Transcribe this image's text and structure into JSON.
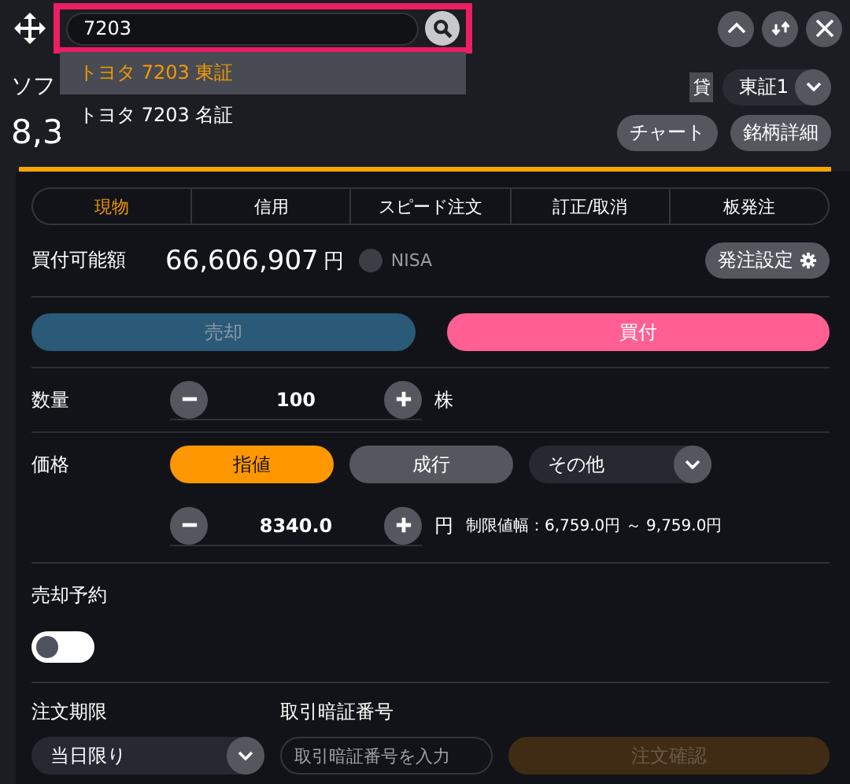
{
  "search": {
    "value": "7203",
    "suggestions": [
      {
        "label": "トヨタ 7203 東証",
        "selected": true
      },
      {
        "label": "トヨタ 7203 名証",
        "selected": false
      }
    ]
  },
  "header": {
    "stock_name": "ソフ",
    "price": "8,3",
    "lending_badge": "貸",
    "market": "東証1",
    "buttons": [
      "チャート",
      "銘柄詳細"
    ]
  },
  "tabs": [
    {
      "label": "現物",
      "selected": true
    },
    {
      "label": "信用",
      "selected": false
    },
    {
      "label": "スピード注文",
      "selected": false
    },
    {
      "label": "訂正/取消",
      "selected": false
    },
    {
      "label": "板発注",
      "selected": false
    }
  ],
  "buying_power": {
    "label": "買付可能額",
    "amount": "66,606,907",
    "unit": "円",
    "nisa": {
      "label": "NISA",
      "checked": false
    },
    "settings_button": "発注設定"
  },
  "sides": [
    {
      "label": "売却",
      "selected": false
    },
    {
      "label": "買付",
      "selected": true
    }
  ],
  "quantity": {
    "label": "数量",
    "value": "100",
    "unit": "株"
  },
  "price": {
    "label": "価格",
    "types": [
      {
        "label": "指値",
        "selected": true
      },
      {
        "label": "成行",
        "selected": false
      }
    ],
    "other": "その他",
    "value": "8340.0",
    "unit": "円",
    "limit_range": "制限値幅：6,759.0円 ～ 9,759.0円"
  },
  "sell_reservation": {
    "label": "売却予約",
    "on": false
  },
  "expiry": {
    "label": "注文期限",
    "value": "当日限り"
  },
  "pin": {
    "label": "取引暗証番号",
    "placeholder": "取引暗証番号を入力"
  },
  "confirm": {
    "label": "注文確認",
    "disabled": true
  }
}
